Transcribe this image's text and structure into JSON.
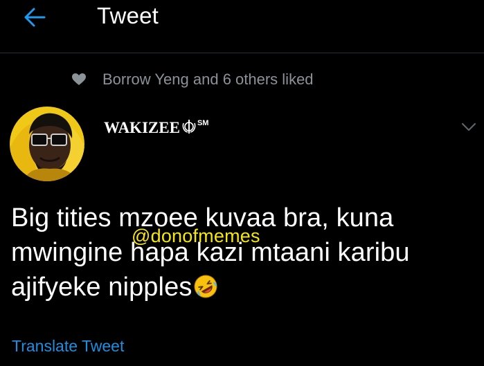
{
  "header": {
    "title": "Tweet",
    "back_icon": "arrow-left-icon",
    "accent_color": "#1d9bf0"
  },
  "social_context": {
    "icon": "heart-icon",
    "text": "Borrow Yeng and 6 others liked"
  },
  "tweet": {
    "author": {
      "display_name": "WAKIZEE",
      "name_symbol_icon": "khanda-icon",
      "name_suffix": "SM",
      "avatar": "avatar"
    },
    "more_icon": "chevron-down-icon",
    "text_lines": [
      "Big tities mzoee kuvaa bra, kuna",
      "mwingine hapa kazi mtaani karibu",
      "ajifyeke nipples"
    ],
    "trailing_emoji": "rolling-on-floor-laughing-icon",
    "translate_label": "Translate Tweet"
  },
  "watermark": {
    "text": "@donofmemes",
    "color": "#f6e70a"
  }
}
